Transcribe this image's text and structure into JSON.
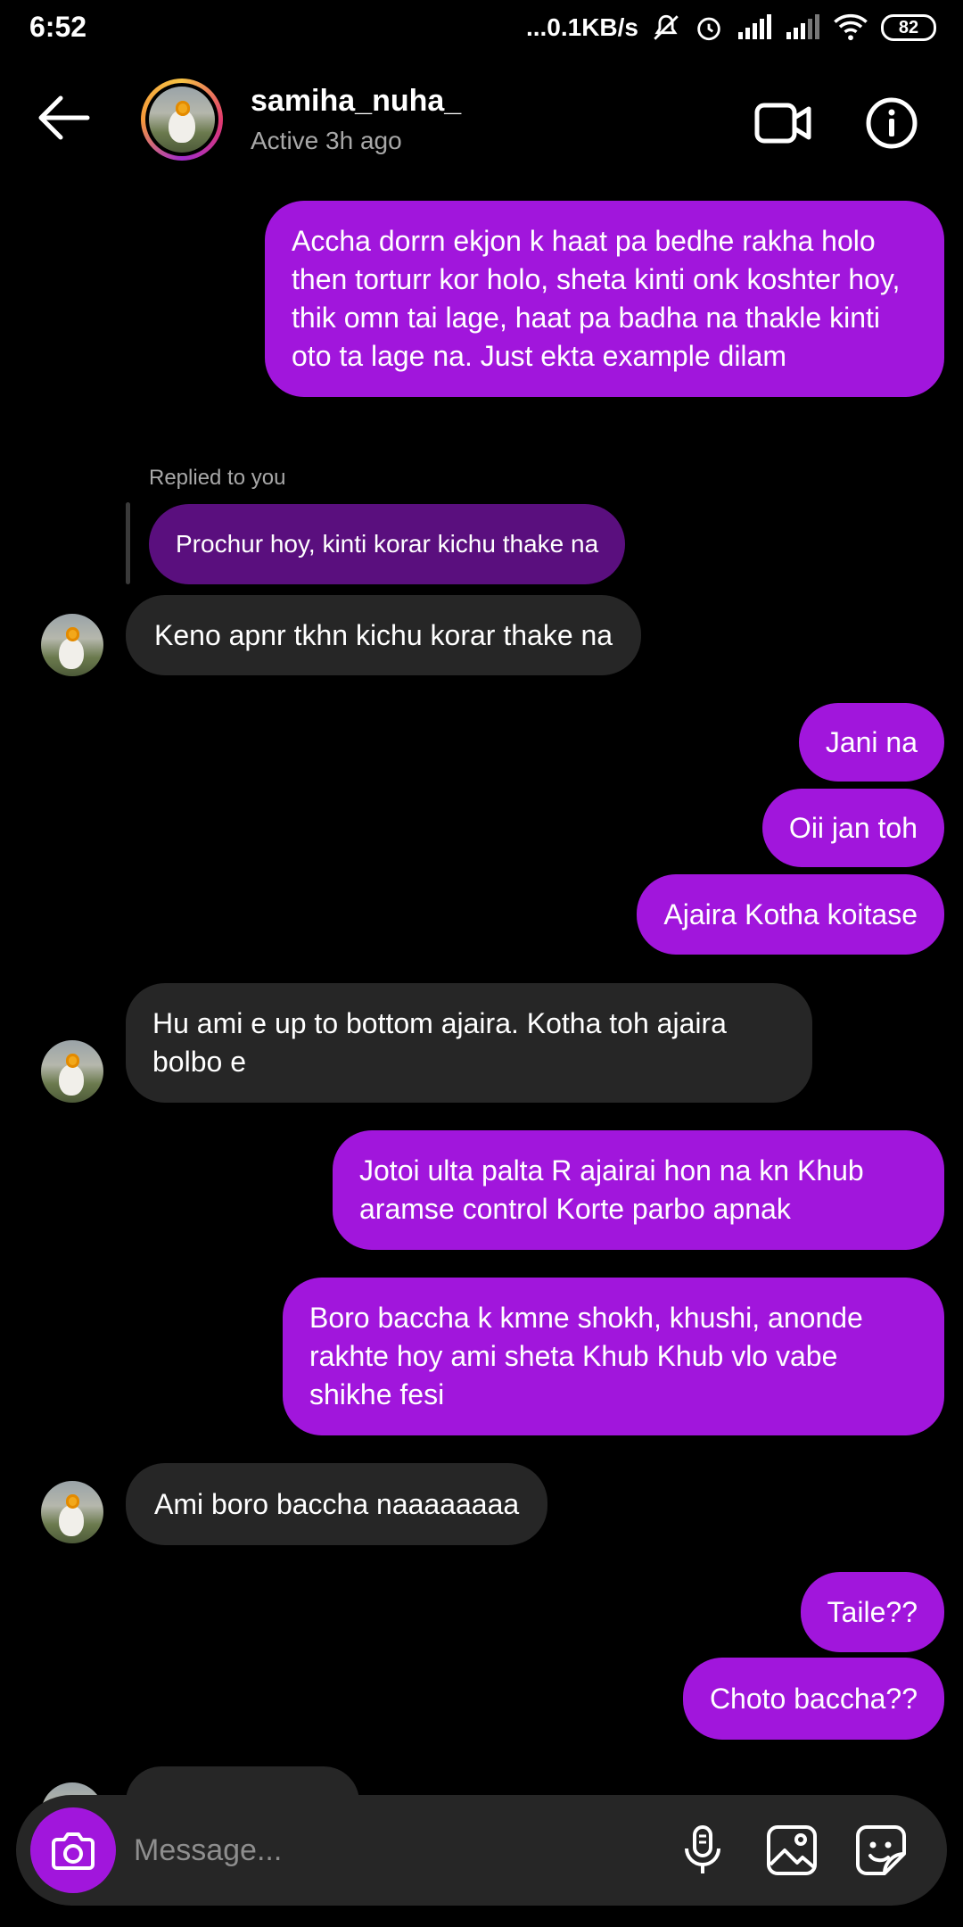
{
  "status_bar": {
    "time": "6:52",
    "speed": "...0.1KB/s",
    "battery": "82"
  },
  "header": {
    "contact_name": "samiha_nuha_",
    "contact_status": "Active 3h ago",
    "back_icon": "arrow-left-icon",
    "video_icon": "video-camera-icon",
    "info_icon": "info-icon"
  },
  "messages": [
    {
      "from": "me",
      "text": "Accha dorrn ekjon k haat pa bedhe rakha holo then torturr kor holo, sheta kinti onk koshter hoy, thik omn tai lage, haat pa badha na thakle kinti oto ta lage na. Just ekta example dilam"
    },
    {
      "from": "them",
      "text": "Keno apnr tkhn kichu korar thake na",
      "reply_label": "Replied to you",
      "reply_text": "Prochur hoy, kinti korar kichu thake na"
    },
    {
      "from": "me",
      "text": "Jani na"
    },
    {
      "from": "me",
      "text": "Oii jan toh"
    },
    {
      "from": "me",
      "text": "Ajaira Kotha koitase"
    },
    {
      "from": "them",
      "text": "Hu ami e up to bottom ajaira. Kotha toh ajaira bolbo e"
    },
    {
      "from": "me",
      "text": "Jotoi ulta palta R ajairai hon na kn Khub aramse control Korte parbo apnak"
    },
    {
      "from": "me",
      "text": "Boro baccha k kmne shokh, khushi, anonde rakhte hoy ami sheta Khub Khub vlo vabe shikhe fesi"
    },
    {
      "from": "them",
      "text": "Ami boro baccha naaaaaaaa"
    },
    {
      "from": "me",
      "text": "Taile??"
    },
    {
      "from": "me",
      "text": "Choto baccha??"
    }
  ],
  "composer": {
    "placeholder": "Message...",
    "camera_icon": "camera-icon",
    "mic_icon": "microphone-icon",
    "gallery_icon": "image-icon",
    "sticker_icon": "sticker-icon"
  },
  "colors": {
    "my_bubble": "#a116dc",
    "their_bubble": "#262626",
    "reply_bubble": "#5a0f7e",
    "background": "#000000"
  }
}
